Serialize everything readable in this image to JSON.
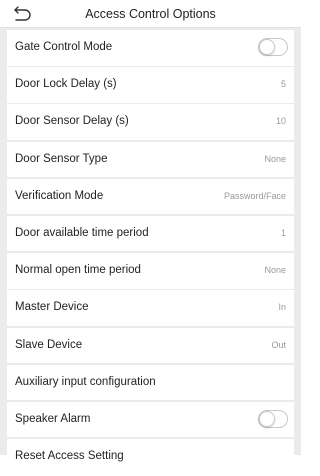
{
  "header": {
    "title": "Access Control Options",
    "back_icon": "back-arrow-icon"
  },
  "rows": [
    {
      "label": "Gate Control Mode",
      "type": "toggle",
      "on": false
    },
    {
      "label": "Door Lock Delay (s)",
      "type": "value",
      "value": "5"
    },
    {
      "label": "Door Sensor Delay (s)",
      "type": "value",
      "value": "10"
    },
    {
      "label": "Door Sensor Type",
      "type": "value",
      "value": "None"
    },
    {
      "label": "Verification Mode",
      "type": "value",
      "value": "Password/Face"
    },
    {
      "label": "Door available time period",
      "type": "value",
      "value": "1"
    },
    {
      "label": "Normal open time period",
      "type": "value",
      "value": "None"
    },
    {
      "label": "Master Device",
      "type": "value",
      "value": "In"
    },
    {
      "label": "Slave Device",
      "type": "value",
      "value": "Out"
    },
    {
      "label": "Auxiliary input configuration",
      "type": "link"
    },
    {
      "label": "Speaker Alarm",
      "type": "toggle",
      "on": false
    },
    {
      "label": "Reset Access Setting",
      "type": "link"
    }
  ],
  "colors": {
    "background": "#ebebeb",
    "row_background": "#ffffff",
    "value_text": "#9a9a9a",
    "toggle_border": "#c8c8c8"
  }
}
